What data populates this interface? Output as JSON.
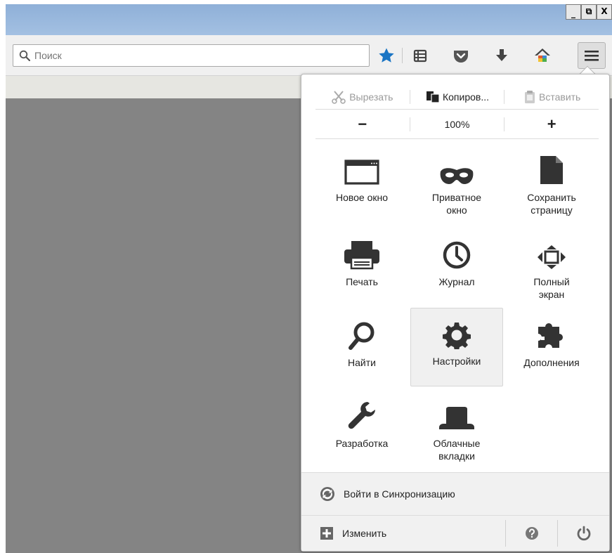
{
  "window": {
    "controls": {
      "minimize": "_",
      "restore": "⧉",
      "close": "X"
    }
  },
  "toolbar": {
    "search": {
      "placeholder": "Поиск",
      "value": ""
    },
    "icons": [
      "star-icon",
      "reading-list-icon",
      "pocket-icon",
      "download-icon",
      "home-icon",
      "hamburger-menu-icon"
    ]
  },
  "menu": {
    "edit": {
      "cut": "Вырезать",
      "copy": "Копиров...",
      "paste": "Вставить"
    },
    "zoom": {
      "minus": "−",
      "level": "100%",
      "plus": "+"
    },
    "items": [
      {
        "label": "Новое окно",
        "icon": "new-window-icon"
      },
      {
        "label": "Приватное окно",
        "icon": "private-mask-icon"
      },
      {
        "label": "Сохранить страницу",
        "icon": "save-page-icon"
      },
      {
        "label": "Печать",
        "icon": "printer-icon"
      },
      {
        "label": "Журнал",
        "icon": "history-clock-icon"
      },
      {
        "label": "Полный экран",
        "icon": "fullscreen-icon"
      },
      {
        "label": "Найти",
        "icon": "find-icon"
      },
      {
        "label": "Настройки",
        "icon": "settings-gear-icon"
      },
      {
        "label": "Дополнения",
        "icon": "addons-puzzle-icon"
      },
      {
        "label": "Разработка",
        "icon": "developer-wrench-icon"
      },
      {
        "label": "Облачные вкладки",
        "icon": "cloud-tabs-hat-icon"
      }
    ],
    "sync": {
      "label": "Войти в Синхронизацию"
    },
    "footer": {
      "customize": "Изменить"
    }
  },
  "colors": {
    "accent_blue": "#1a75c4",
    "content_bg": "#848484",
    "icon_dark": "#333333"
  }
}
